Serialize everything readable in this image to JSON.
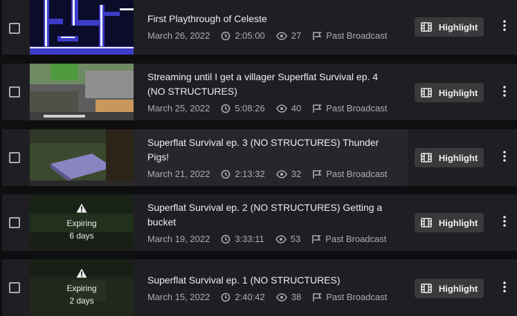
{
  "videos": [
    {
      "title": "First Playthrough of Celeste",
      "date": "March 26, 2022",
      "duration": "2:05:00",
      "views": "27",
      "type": "Past Broadcast",
      "expiring": false
    },
    {
      "title": "Streaming until I get a villager Superflat Survival ep. 4 (NO STRUCTURES)",
      "date": "March 25, 2022",
      "duration": "5:08:26",
      "views": "40",
      "type": "Past Broadcast",
      "expiring": false
    },
    {
      "title": "Superflat Survival ep. 3 (NO STRUCTURES) Thunder Pigs!",
      "date": "March 21, 2022",
      "duration": "2:13:32",
      "views": "32",
      "type": "Past Broadcast",
      "expiring": false
    },
    {
      "title": "Superflat Survival ep. 2 (NO STRUCTURES) Getting a bucket",
      "date": "March 19, 2022",
      "duration": "3:33:11",
      "views": "53",
      "type": "Past Broadcast",
      "expiring": true,
      "expiring_label": "Expiring",
      "expiring_days": "6 days"
    },
    {
      "title": "Superflat Survival ep. 1 (NO STRUCTURES)",
      "date": "March 15, 2022",
      "duration": "2:40:42",
      "views": "38",
      "type": "Past Broadcast",
      "expiring": true,
      "expiring_label": "Expiring",
      "expiring_days": "2 days"
    }
  ],
  "highlight_label": "Highlight",
  "colors": {
    "background": "#0e0e10",
    "row": "#1f1f23",
    "button": "#3a3a3d",
    "muted_text": "#adadb8"
  }
}
